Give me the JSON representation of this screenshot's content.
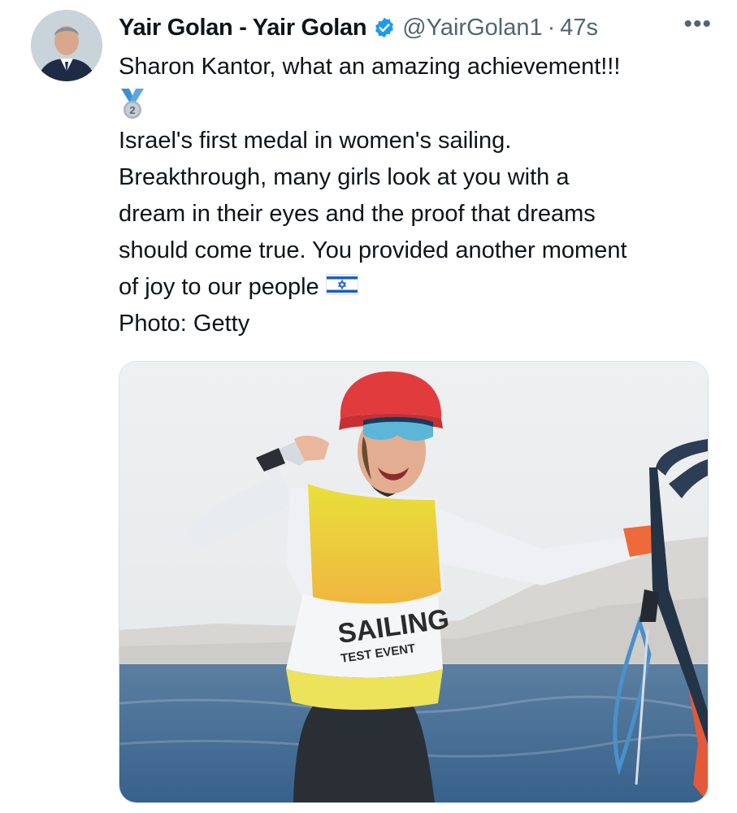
{
  "tweet": {
    "author_name": "Yair Golan - Yair Golan",
    "handle": "@YairGolan1",
    "separator": "·",
    "time": "47s",
    "more": "•••",
    "lines": {
      "l1": "Sharon Kantor, what an amazing achievement!!!",
      "l2": "Israel's first medal in women's sailing.",
      "l3": "Breakthrough, many girls look at you with a",
      "l4": "dream in their eyes and the proof that dreams",
      "l5": "should come true. You provided another moment",
      "l6": "of joy to our people",
      "l7": "Photo: Getty"
    },
    "medal_number": "2",
    "bib_text_1": "SAILING",
    "bib_text_2": "TEST EVENT"
  },
  "icons": {
    "verified": "verified-badge-icon",
    "medal": "second-place-medal-icon",
    "flag": "israel-flag-icon",
    "more": "more-options-icon"
  },
  "colors": {
    "verified_blue": "#1d9bf0",
    "secondary_text": "#536471",
    "primary_text": "#0f1419"
  }
}
